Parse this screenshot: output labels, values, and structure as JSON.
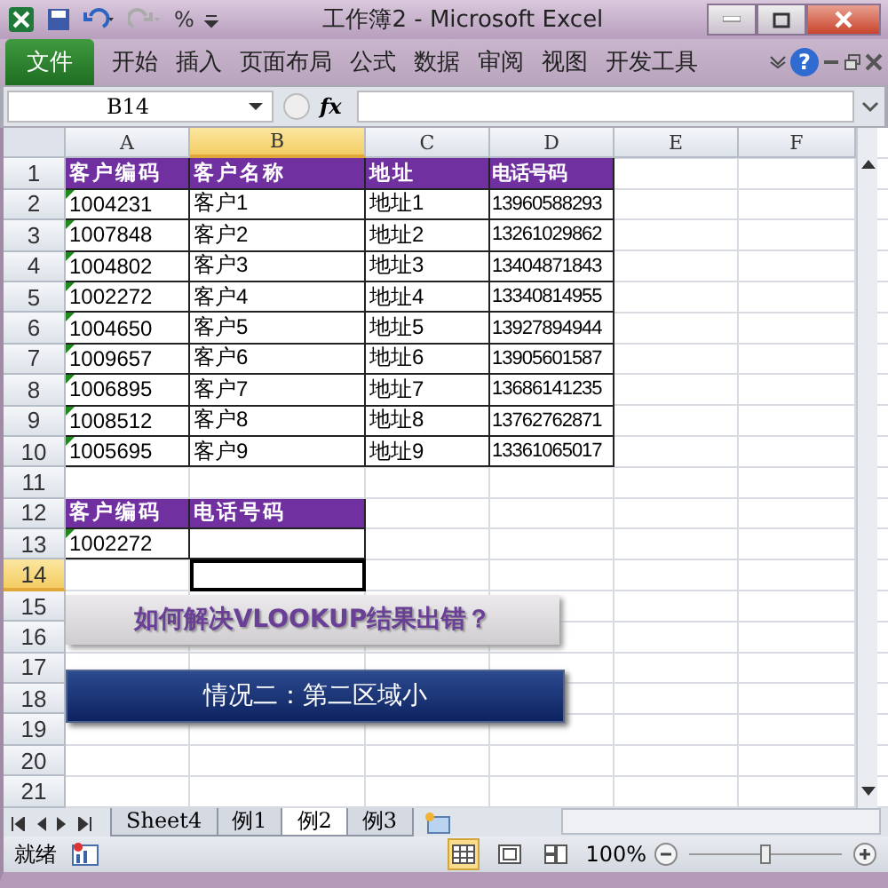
{
  "title_bar": {
    "title": "工作簿2 - Microsoft Excel",
    "percent_button": "%"
  },
  "ribbon": {
    "tabs": [
      {
        "label": "文件",
        "kind": "file",
        "selected": false
      },
      {
        "label": "开始",
        "kind": "tab",
        "selected": false
      },
      {
        "label": "插入",
        "kind": "tab",
        "selected": false
      },
      {
        "label": "页面布局",
        "kind": "tab",
        "selected": false
      },
      {
        "label": "公式",
        "kind": "tab",
        "selected": false
      },
      {
        "label": "数据",
        "kind": "tab",
        "selected": false
      },
      {
        "label": "审阅",
        "kind": "tab",
        "selected": false
      },
      {
        "label": "视图",
        "kind": "tab",
        "selected": false
      },
      {
        "label": "开发工具",
        "kind": "tab",
        "selected": false
      }
    ],
    "help": "?"
  },
  "formula_bar": {
    "name_box": "B14",
    "fx": "fx"
  },
  "columns": [
    {
      "label": "A",
      "selected": false
    },
    {
      "label": "B",
      "selected": true
    },
    {
      "label": "C",
      "selected": false
    },
    {
      "label": "D",
      "selected": false
    },
    {
      "label": "E",
      "selected": false
    },
    {
      "label": "F",
      "selected": false
    }
  ],
  "rows": [
    {
      "number": "1",
      "selected": false,
      "cells": [
        {
          "text": "客户编码",
          "kind": "header",
          "flag": false,
          "selected": false
        },
        {
          "text": "客户名称",
          "kind": "header",
          "flag": false,
          "selected": false
        },
        {
          "text": "地址",
          "kind": "header",
          "flag": false,
          "selected": false
        },
        {
          "text": "电话号码",
          "kind": "header",
          "flag": false,
          "selected": false
        }
      ]
    },
    {
      "number": "2",
      "selected": false,
      "cells": [
        {
          "text": "1004231",
          "kind": "data",
          "flag": true,
          "selected": false
        },
        {
          "text": "客户1",
          "kind": "data",
          "flag": false,
          "selected": false
        },
        {
          "text": "地址1",
          "kind": "data",
          "flag": false,
          "selected": false
        },
        {
          "text": "13960588293",
          "kind": "data",
          "flag": false,
          "selected": false
        }
      ]
    },
    {
      "number": "3",
      "selected": false,
      "cells": [
        {
          "text": "1007848",
          "kind": "data",
          "flag": true,
          "selected": false
        },
        {
          "text": "客户2",
          "kind": "data",
          "flag": false,
          "selected": false
        },
        {
          "text": "地址2",
          "kind": "data",
          "flag": false,
          "selected": false
        },
        {
          "text": "13261029862",
          "kind": "data",
          "flag": false,
          "selected": false
        }
      ]
    },
    {
      "number": "4",
      "selected": false,
      "cells": [
        {
          "text": "1004802",
          "kind": "data",
          "flag": true,
          "selected": false
        },
        {
          "text": "客户3",
          "kind": "data",
          "flag": false,
          "selected": false
        },
        {
          "text": "地址3",
          "kind": "data",
          "flag": false,
          "selected": false
        },
        {
          "text": "13404871843",
          "kind": "data",
          "flag": false,
          "selected": false
        }
      ]
    },
    {
      "number": "5",
      "selected": false,
      "cells": [
        {
          "text": "1002272",
          "kind": "data",
          "flag": true,
          "selected": false
        },
        {
          "text": "客户4",
          "kind": "data",
          "flag": false,
          "selected": false
        },
        {
          "text": "地址4",
          "kind": "data",
          "flag": false,
          "selected": false
        },
        {
          "text": "13340814955",
          "kind": "data",
          "flag": false,
          "selected": false
        }
      ]
    },
    {
      "number": "6",
      "selected": false,
      "cells": [
        {
          "text": "1004650",
          "kind": "data",
          "flag": true,
          "selected": false
        },
        {
          "text": "客户5",
          "kind": "data",
          "flag": false,
          "selected": false
        },
        {
          "text": "地址5",
          "kind": "data",
          "flag": false,
          "selected": false
        },
        {
          "text": "13927894944",
          "kind": "data",
          "flag": false,
          "selected": false
        }
      ]
    },
    {
      "number": "7",
      "selected": false,
      "cells": [
        {
          "text": "1009657",
          "kind": "data",
          "flag": true,
          "selected": false
        },
        {
          "text": "客户6",
          "kind": "data",
          "flag": false,
          "selected": false
        },
        {
          "text": "地址6",
          "kind": "data",
          "flag": false,
          "selected": false
        },
        {
          "text": "13905601587",
          "kind": "data",
          "flag": false,
          "selected": false
        }
      ]
    },
    {
      "number": "8",
      "selected": false,
      "cells": [
        {
          "text": "1006895",
          "kind": "data",
          "flag": true,
          "selected": false
        },
        {
          "text": "客户7",
          "kind": "data",
          "flag": false,
          "selected": false
        },
        {
          "text": "地址7",
          "kind": "data",
          "flag": false,
          "selected": false
        },
        {
          "text": "13686141235",
          "kind": "data",
          "flag": false,
          "selected": false
        }
      ]
    },
    {
      "number": "9",
      "selected": false,
      "cells": [
        {
          "text": "1008512",
          "kind": "data",
          "flag": true,
          "selected": false
        },
        {
          "text": "客户8",
          "kind": "data",
          "flag": false,
          "selected": false
        },
        {
          "text": "地址8",
          "kind": "data",
          "flag": false,
          "selected": false
        },
        {
          "text": "13762762871",
          "kind": "data",
          "flag": false,
          "selected": false
        }
      ]
    },
    {
      "number": "10",
      "selected": false,
      "cells": [
        {
          "text": "1005695",
          "kind": "data",
          "flag": true,
          "selected": false
        },
        {
          "text": "客户9",
          "kind": "data",
          "flag": false,
          "selected": false
        },
        {
          "text": "地址9",
          "kind": "data",
          "flag": false,
          "selected": false
        },
        {
          "text": "13361065017",
          "kind": "data",
          "flag": false,
          "selected": false
        }
      ]
    },
    {
      "number": "11",
      "selected": false,
      "cells": []
    },
    {
      "number": "12",
      "selected": false,
      "cells": [
        {
          "text": "客户编码",
          "kind": "header",
          "flag": false,
          "selected": false
        },
        {
          "text": "电话号码",
          "kind": "header",
          "flag": false,
          "selected": false
        }
      ]
    },
    {
      "number": "13",
      "selected": false,
      "cells": [
        {
          "text": "1002272",
          "kind": "data",
          "flag": true,
          "selected": false
        },
        {
          "kind": "data",
          "flag": false,
          "selected": false
        }
      ]
    },
    {
      "number": "14",
      "selected": true,
      "cells": [
        {
          "kind": "blank",
          "flag": false,
          "selected": false
        },
        {
          "kind": "blank",
          "flag": false,
          "selected": true
        }
      ]
    },
    {
      "number": "15",
      "selected": false,
      "cells": []
    },
    {
      "number": "16",
      "selected": false,
      "cells": []
    },
    {
      "number": "17",
      "selected": false,
      "cells": []
    },
    {
      "number": "18",
      "selected": false,
      "cells": []
    },
    {
      "number": "19",
      "selected": false,
      "cells": []
    },
    {
      "number": "20",
      "selected": false,
      "cells": []
    },
    {
      "number": "21",
      "selected": false,
      "cells": []
    }
  ],
  "banners": [
    {
      "text": "如何解决VLOOKUP结果出错？",
      "kind": "question"
    },
    {
      "text": "情况二：第二区域小",
      "kind": "case"
    }
  ],
  "sheet_tabs": [
    {
      "label": "Sheet4",
      "selected": false
    },
    {
      "label": "例1",
      "selected": false
    },
    {
      "label": "例2",
      "selected": true
    },
    {
      "label": "例3",
      "selected": false
    }
  ],
  "status_bar": {
    "status": "就绪",
    "zoom": "100%",
    "zoom_slider": {
      "level": 0.5
    },
    "views": [
      {
        "kind": "normal",
        "selected": true
      },
      {
        "kind": "layout",
        "selected": false
      },
      {
        "kind": "pagebreak",
        "selected": false
      }
    ]
  }
}
